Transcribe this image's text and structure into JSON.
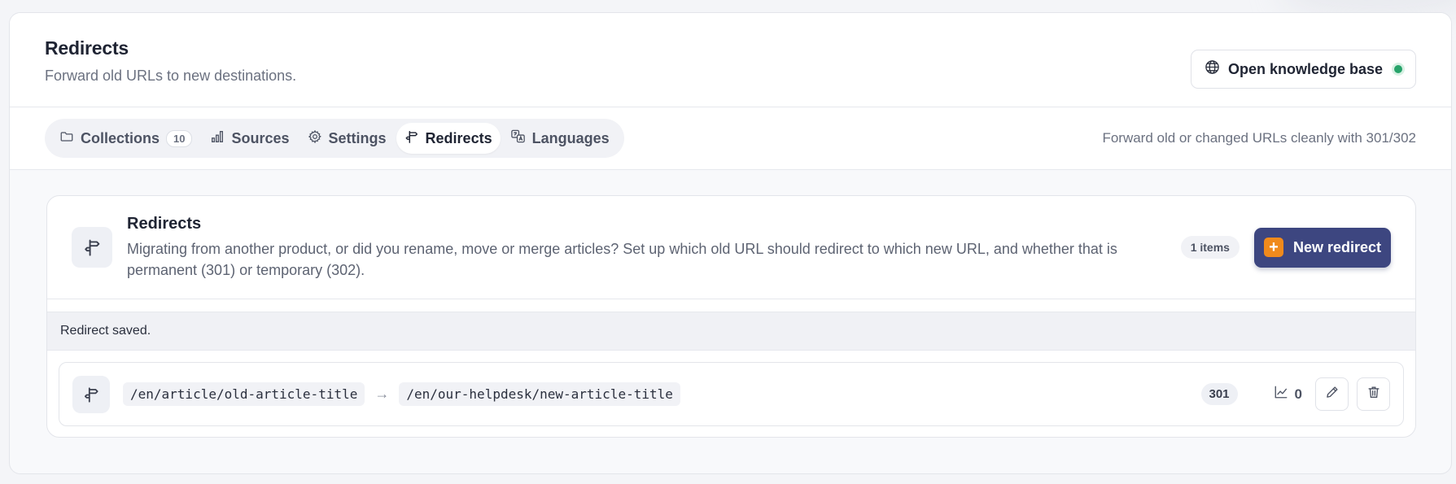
{
  "header": {
    "title": "Redirects",
    "subtitle": "Forward old URLs to new destinations.",
    "kb_button": "Open knowledge base"
  },
  "tabs": [
    {
      "label": "Collections",
      "count": "10",
      "icon": "folder-icon"
    },
    {
      "label": "Sources",
      "icon": "bar-chart-icon"
    },
    {
      "label": "Settings",
      "icon": "gear-icon"
    },
    {
      "label": "Redirects",
      "icon": "signpost-icon",
      "active": true
    },
    {
      "label": "Languages",
      "icon": "translate-icon"
    }
  ],
  "tabbar_hint": "Forward old or changed URLs cleanly with 301/302",
  "card": {
    "title": "Redirects",
    "description": "Migrating from another product, or did you rename, move or merge articles? Set up which old URL should redirect to which new URL, and whether that is permanent (301) or temporary (302).",
    "items_badge": "1 items",
    "new_button": "New redirect",
    "new_button_icon": "+"
  },
  "toast": "Redirect saved.",
  "redirects": [
    {
      "from": "/en/article/old-article-title",
      "to": "/en/our-helpdesk/new-article-title",
      "code": "301",
      "hits": "0"
    }
  ],
  "arrow": "→",
  "colors": {
    "primary": "#3d4680",
    "accent": "#f08a1c",
    "status_green": "#27a36a"
  }
}
